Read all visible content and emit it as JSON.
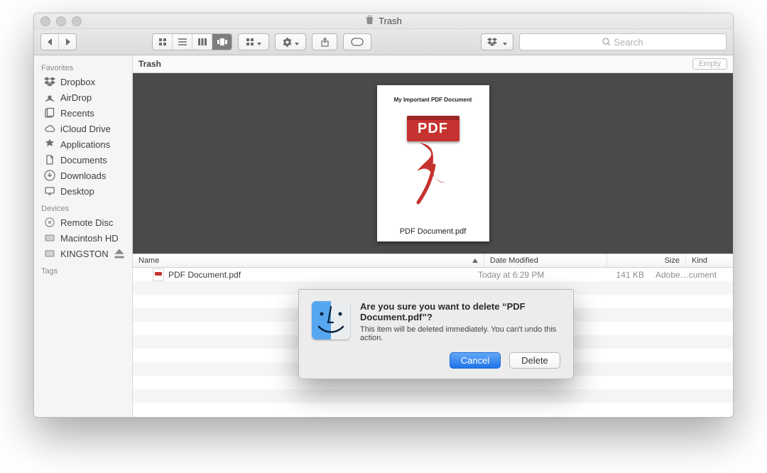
{
  "window": {
    "title": "Trash"
  },
  "toolbar": {
    "search_placeholder": "Search"
  },
  "pathbar": {
    "location": "Trash",
    "empty_label": "Empty"
  },
  "sidebar": {
    "favorites_label": "Favorites",
    "devices_label": "Devices",
    "tags_label": "Tags",
    "favorites": [
      {
        "label": "Dropbox"
      },
      {
        "label": "AirDrop"
      },
      {
        "label": "Recents"
      },
      {
        "label": "iCloud Drive"
      },
      {
        "label": "Applications"
      },
      {
        "label": "Documents"
      },
      {
        "label": "Downloads"
      },
      {
        "label": "Desktop"
      }
    ],
    "devices": [
      {
        "label": "Remote Disc"
      },
      {
        "label": "Macintosh HD"
      },
      {
        "label": "KINGSTON"
      }
    ]
  },
  "preview": {
    "doc_title": "My Important PDF Document",
    "badge_text": "PDF",
    "filename": "PDF Document.pdf"
  },
  "columns": {
    "name": "Name",
    "date": "Date Modified",
    "size": "Size",
    "kind": "Kind"
  },
  "rows": [
    {
      "name": "PDF Document.pdf",
      "date": "Today at 6:29 PM",
      "size": "141 KB",
      "kind": "Adobe…cument"
    }
  ],
  "dialog": {
    "heading": "Are you sure you want to delete “PDF Document.pdf”?",
    "body": "This item will be deleted immediately. You can't undo this action.",
    "cancel": "Cancel",
    "delete": "Delete"
  }
}
